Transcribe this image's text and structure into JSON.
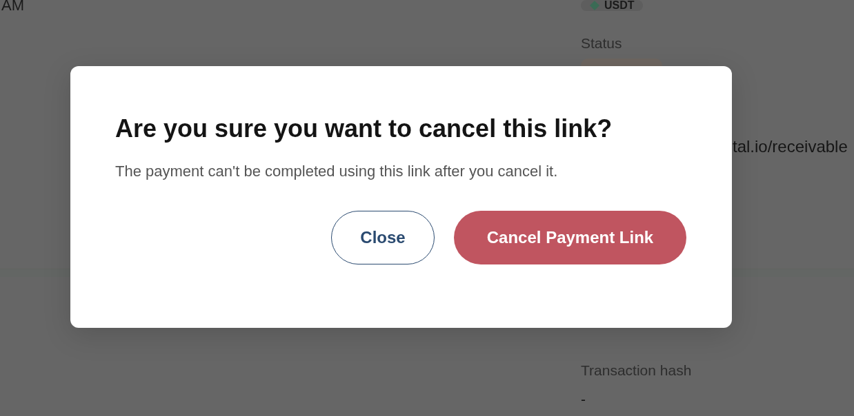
{
  "page": {
    "time_suffix": "AM",
    "currency_badge": "USDT",
    "status_label": "Status",
    "link_text": "tal.io/receivable",
    "hash_label": "Transaction hash",
    "hash_value": "-"
  },
  "dialog": {
    "title": "Are you sure you want to cancel this link?",
    "message": "The payment can't be completed using this link after you cancel it.",
    "buttons": [
      {
        "label": "Close",
        "kind": "secondary"
      },
      {
        "label": "Cancel Payment Link",
        "kind": "danger"
      }
    ]
  }
}
